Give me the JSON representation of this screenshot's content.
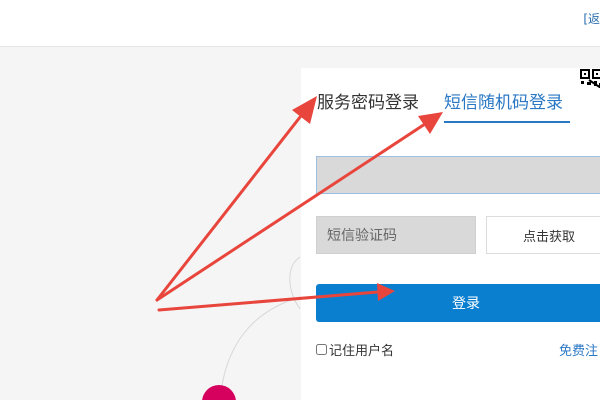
{
  "header": {
    "top_link": "[返"
  },
  "login": {
    "tabs": [
      {
        "label": "服务密码登录",
        "active": false
      },
      {
        "label": "短信随机码登录",
        "active": true
      }
    ],
    "phone_value": "",
    "sms_code_placeholder": "短信验证码",
    "get_code_label": "点击获取",
    "login_label": "登录",
    "remember_label": "记住用户名",
    "register_label": "免费注"
  },
  "icons": {
    "qr": "qr-code-icon"
  },
  "colors": {
    "accent": "#2a78c4",
    "login_button": "#0a7fd0",
    "arrow": "#e8453c",
    "background": "#f5f5f5",
    "dot": "#d6005f"
  }
}
